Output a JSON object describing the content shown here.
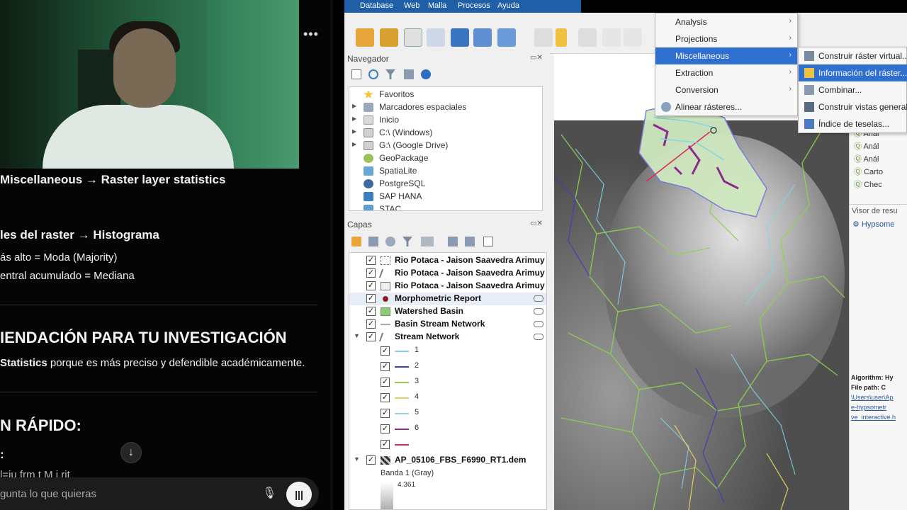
{
  "chat": {
    "lines": [
      "Miscellaneous → Raster layer statistics",
      "les del raster → Histograma",
      "ás alto = Moda (Majority)",
      "entral acumulado = Mediana",
      "IENDACIÓN PARA TU INVESTIGACIÓN",
      "N RÁPIDO:",
      ":",
      "l=ju frm  t    M j rit"
    ],
    "recommend_bold": "Statistics",
    "recommend_rest": " porque es más preciso y defendible académicamente.",
    "input_placeholder": "gunta lo que quieras",
    "more_icon": "•••",
    "scroll_icon": "↓",
    "mic_icon": "🎙",
    "voice_icon": "|||"
  },
  "qgis": {
    "menubar": [
      "Database",
      "Web",
      "Malla",
      "Procesos",
      "Ayuda"
    ],
    "navigator": {
      "title": "Navegador",
      "items": [
        {
          "label": "Favoritos",
          "color": "#f2c12e"
        },
        {
          "label": "Marcadores espaciales",
          "color": "#9aa7b6"
        },
        {
          "label": "Inicio",
          "color": "#d8d8d8"
        },
        {
          "label": "C:\\ (Windows)",
          "color": "#cfcfcf"
        },
        {
          "label": "G:\\ (Google Drive)",
          "color": "#cfcfcf"
        },
        {
          "label": "GeoPackage",
          "color": "#9bc25b"
        },
        {
          "label": "SpatiaLite",
          "color": "#6aa7d8"
        },
        {
          "label": "PostgreSQL",
          "color": "#3e6aa3"
        },
        {
          "label": "SAP HANA",
          "color": "#3a7fc4"
        },
        {
          "label": "STAC",
          "color": "#5aa0d0"
        }
      ]
    },
    "layers": {
      "title": "Capas",
      "items": [
        {
          "label": "Rio Potaca - Jaison Saavedra Arimuy",
          "kind": "point"
        },
        {
          "label": "Rio Potaca - Jaison Saavedra Arimuy",
          "kind": "line"
        },
        {
          "label": "Rio Potaca - Jaison Saavedra Arimuy",
          "kind": "poly"
        },
        {
          "label": "Morphometric Report",
          "kind": "report"
        },
        {
          "label": "Watershed Basin",
          "kind": "basin"
        },
        {
          "label": "Basin Stream Network",
          "kind": "network"
        },
        {
          "label": "Stream Network",
          "kind": "stream"
        }
      ],
      "classes": [
        {
          "label": "1",
          "color": "#7fd6e6"
        },
        {
          "label": "2",
          "color": "#3b3fb5"
        },
        {
          "label": "3",
          "color": "#8fd14f"
        },
        {
          "label": "4",
          "color": "#e0d060"
        },
        {
          "label": "5",
          "color": "#8fd6ea"
        },
        {
          "label": "6",
          "color": "#8a2a8a"
        },
        {
          "label": "",
          "color": "#e02a5a"
        }
      ],
      "dem_label": "AP_05106_FBS_F6990_RT1.dem",
      "band_label": "Banda 1 (Gray)",
      "band_max": "4.361"
    },
    "raster_menu": {
      "items": [
        {
          "label": "Analysis"
        },
        {
          "label": "Projections"
        },
        {
          "label": "Miscellaneous"
        },
        {
          "label": "Extraction"
        },
        {
          "label": "Conversion"
        },
        {
          "label": "Alinear rásteres..."
        }
      ]
    },
    "misc_submenu": {
      "items": [
        "Construir ráster virtual...",
        "Información del ráster...",
        "Combinar...",
        "Construir vistas generales...",
        "Índice de teselas..."
      ]
    },
    "right_panel": {
      "items": [
        "Anál",
        "Anál",
        "Anál",
        "Carto",
        "Chec"
      ],
      "results_title": "Visor de resu",
      "results_item": "Hypsome",
      "info_lines": [
        "Algorithm: Hy",
        "File path: C",
        "\\Users\\user\\Ap",
        "e-hypsometr",
        "ve_interactive.h"
      ]
    }
  }
}
